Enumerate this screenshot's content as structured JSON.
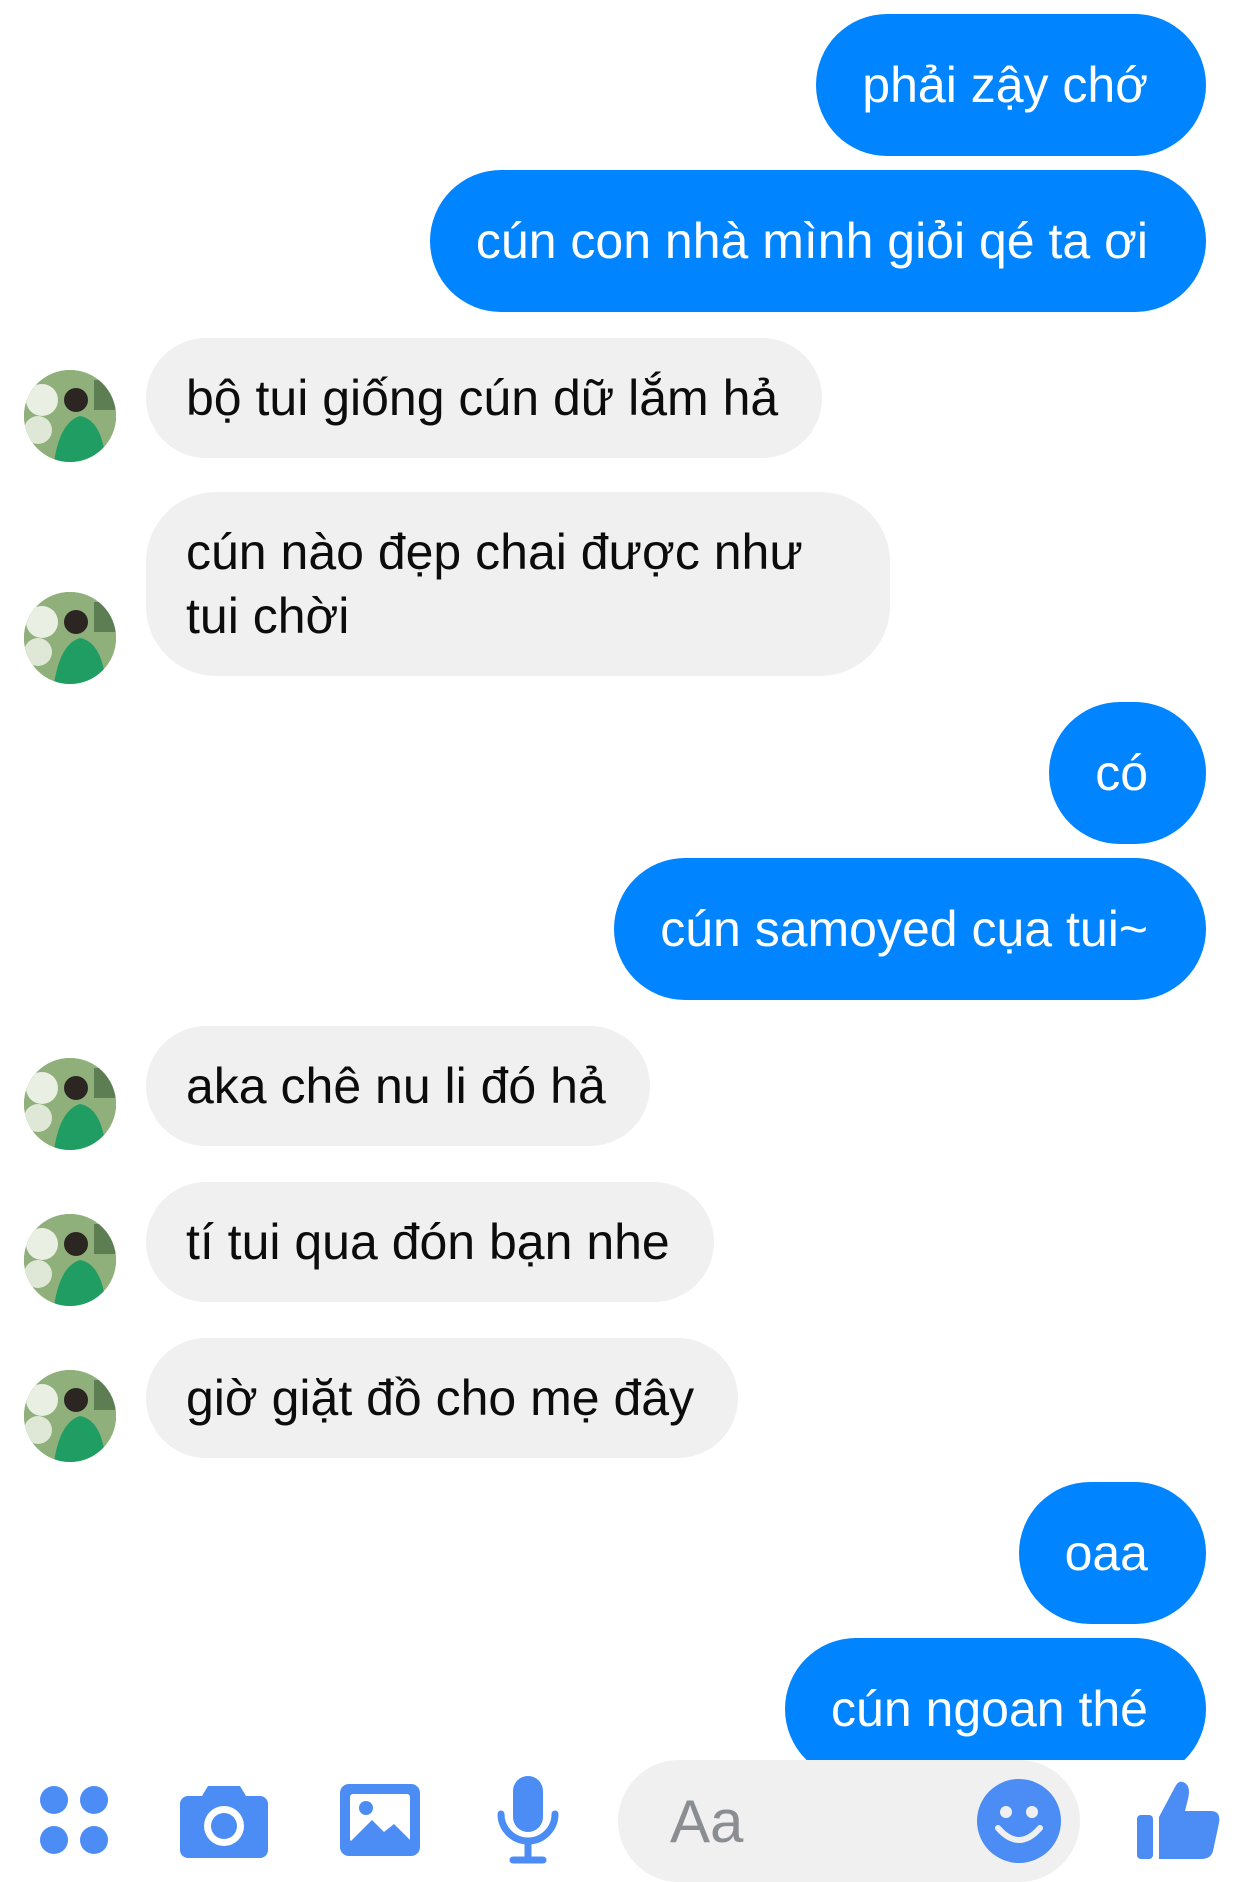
{
  "thread": {
    "messages": [
      {
        "side": "out",
        "text": "phải zậy chớ"
      },
      {
        "side": "out",
        "text": "cún con nhà mình giỏi qé ta ơi"
      },
      {
        "side": "in",
        "text": "bộ tui giống cún dữ lắm hả"
      },
      {
        "side": "in",
        "text": "cún nào đẹp chai được như tui chời"
      },
      {
        "side": "out",
        "text": "có"
      },
      {
        "side": "out",
        "text": "cún samoyed cụa tui~"
      },
      {
        "side": "in",
        "text": "aka chê nu li đó hả"
      },
      {
        "side": "in",
        "text": "tí tui qua đón bạn nhe"
      },
      {
        "side": "in",
        "text": "giờ giặt đồ cho mẹ đây"
      },
      {
        "side": "out",
        "text": "oaa"
      },
      {
        "side": "out",
        "text": "cún ngoan thé"
      }
    ]
  },
  "composer": {
    "placeholder": "Aa",
    "icons": [
      "menu-dots-icon",
      "camera-icon",
      "gallery-icon",
      "microphone-icon",
      "emoji-icon",
      "thumbs-up-icon"
    ]
  },
  "colors": {
    "accent": "#0084ff",
    "icon": "#4b8cf5",
    "incoming_bubble": "#f1f0f0",
    "outgoing_text": "#ffffff",
    "incoming_text": "#0c0c0c"
  }
}
